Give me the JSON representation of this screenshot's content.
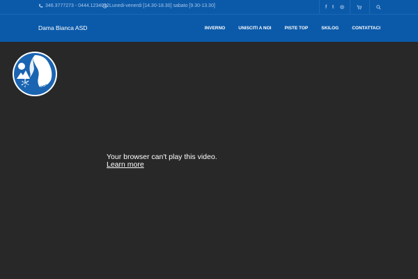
{
  "topbar": {
    "phone": "346.3777273 - 0444.1234012",
    "hours": "Lunedi-venerdi [14.30-18.30] sabato [9.30-13.30]",
    "social": [
      {
        "icon": "facebook-icon",
        "glyph": "f"
      },
      {
        "icon": "twitter-icon",
        "glyph": "t"
      },
      {
        "icon": "instagram-icon",
        "glyph": "◎"
      }
    ]
  },
  "navbar": {
    "brand": "Dama Bianca ASD",
    "menu": [
      "INVERNO",
      "UNISCITI A NOI",
      "PISTE TOP",
      "SKILOG",
      "CONTATTACI"
    ]
  },
  "logo": {
    "text": "Dama Bianca"
  },
  "video": {
    "message": "Your browser can't play this video.",
    "learn_more": "Learn more"
  },
  "colors": {
    "header_bg": "#0b5aaa",
    "topbar_text": "#a9c6e8",
    "video_bg": "#282828"
  }
}
